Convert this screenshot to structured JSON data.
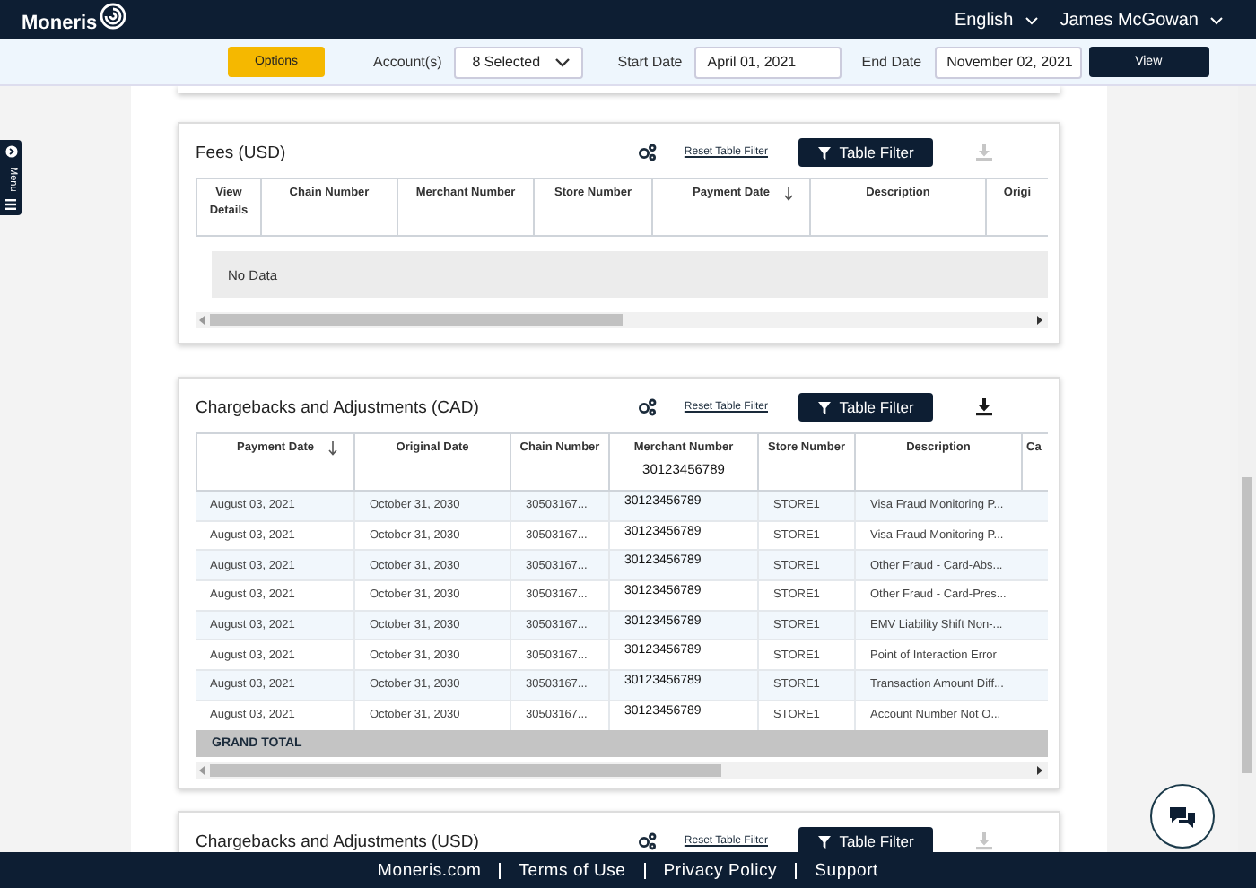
{
  "header": {
    "logo": "Moneris",
    "language": "English",
    "user": "James McGowan"
  },
  "side_menu": {
    "label": "Menu"
  },
  "filters": {
    "options_button": "Options",
    "account_label": "Account(s)",
    "account_value": "8 Selected",
    "start_label": "Start Date",
    "start_value": "April 01, 2021",
    "end_label": "End Date",
    "end_value": "November 02, 2021",
    "view_button": "View"
  },
  "cards": [
    {
      "title": "Fees (USD)",
      "reset_link": "Reset Table Filter",
      "filter_button": "Table Filter",
      "download_disabled": true,
      "columns": [
        {
          "label": "View Details",
          "sorted": false
        },
        {
          "label": "Chain Number",
          "sorted": false
        },
        {
          "label": "Merchant Number",
          "sorted": false
        },
        {
          "label": "Store Number",
          "sorted": false
        },
        {
          "label": "Payment Date",
          "sorted": true
        },
        {
          "label": "Description",
          "sorted": false
        },
        {
          "label": "Origi",
          "sorted": false
        }
      ],
      "no_data": "No Data"
    },
    {
      "title": "Chargebacks and Adjustments (CAD)",
      "reset_link": "Reset Table Filter",
      "filter_button": "Table Filter",
      "download_disabled": false,
      "columns": [
        {
          "label": "Payment Date",
          "sorted": true
        },
        {
          "label": "Original Date",
          "sorted": false
        },
        {
          "label": "Chain Number",
          "sorted": false
        },
        {
          "label": "Merchant Number",
          "sorted": false,
          "sub": "30123456789"
        },
        {
          "label": "Store Number",
          "sorted": false
        },
        {
          "label": "Description",
          "sorted": false
        },
        {
          "label": "Ca"
        }
      ],
      "rows": [
        [
          "August 03, 2021",
          "October 31, 2030",
          "30503167...",
          "30123456789",
          "STORE1",
          "Visa Fraud Monitoring P..."
        ],
        [
          "August 03, 2021",
          "October 31, 2030",
          "30503167...",
          "30123456789",
          "STORE1",
          "Visa Fraud Monitoring P..."
        ],
        [
          "August 03, 2021",
          "October 31, 2030",
          "30503167...",
          "30123456789",
          "STORE1",
          "Other Fraud - Card-Abs..."
        ],
        [
          "August 03, 2021",
          "October 31, 2030",
          "30503167...",
          "30123456789",
          "STORE1",
          "Other Fraud - Card-Pres..."
        ],
        [
          "August 03, 2021",
          "October 31, 2030",
          "30503167...",
          "30123456789",
          "STORE1",
          "EMV Liability Shift Non-..."
        ],
        [
          "August 03, 2021",
          "October 31, 2030",
          "30503167...",
          "30123456789",
          "STORE1",
          "Point of Interaction Error"
        ],
        [
          "August 03, 2021",
          "October 31, 2030",
          "30503167...",
          "30123456789",
          "STORE1",
          "Transaction Amount Diff..."
        ],
        [
          "August 03, 2021",
          "October 31, 2030",
          "30503167...",
          "30123456789",
          "STORE1",
          "Account Number Not O..."
        ]
      ],
      "grand_total": "GRAND TOTAL"
    },
    {
      "title": "Chargebacks and Adjustments (USD)",
      "reset_link": "Reset Table Filter",
      "filter_button": "Table Filter",
      "download_disabled": true
    }
  ],
  "footer": {
    "links": [
      "Moneris.com",
      "Terms of Use",
      "Privacy Policy",
      "Support"
    ]
  }
}
